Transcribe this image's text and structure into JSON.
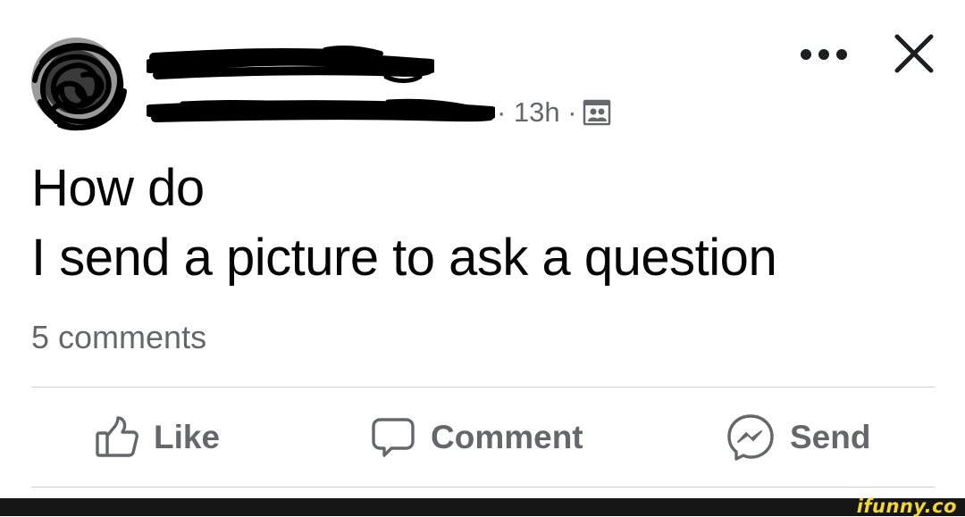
{
  "header": {
    "meta": "· 13h ·"
  },
  "actions": {
    "more_icon": "more-dots-icon",
    "close_icon": "close-x-icon"
  },
  "post": {
    "lines": [
      "How do",
      "I send a picture to ask a question"
    ],
    "comment_count": "5 comments"
  },
  "action_bar": {
    "like_label": "Like",
    "comment_label": "Comment",
    "send_label": "Send",
    "icons": [
      "thumbs-up-icon",
      "comment-bubble-icon",
      "messenger-icon"
    ]
  },
  "watermark": {
    "text": "ifunny.co"
  },
  "colors": {
    "primary_text": "#050505",
    "secondary_text": "#65676b",
    "divider": "#ced0d4",
    "watermark_bar": "#161616",
    "watermark_text": "#f5d62a"
  }
}
